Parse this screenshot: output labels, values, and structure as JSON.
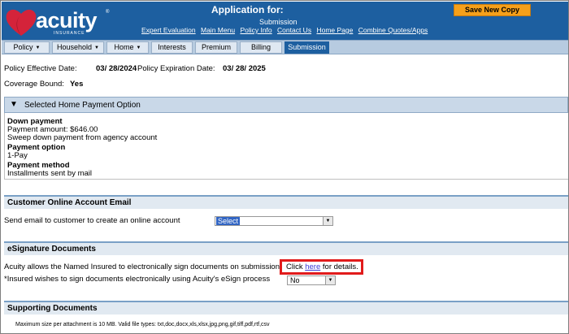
{
  "header": {
    "logo_text": "acuity",
    "logo_sub": "INSURANCE",
    "logo_reg": "®",
    "app_title": "Application for:",
    "app_subtitle": "Submission",
    "links": [
      "Expert Evaluation",
      "Main Menu",
      "Policy Info",
      "Contact Us",
      "Home Page",
      "Combine Quotes/Apps"
    ],
    "save_label": "Save New Copy"
  },
  "nav": {
    "tabs": [
      {
        "label": "Policy",
        "dropdown": true
      },
      {
        "label": "Household",
        "dropdown": true
      },
      {
        "label": "Home",
        "dropdown": true
      },
      {
        "label": "Interests",
        "dropdown": false
      },
      {
        "label": "Premium",
        "dropdown": false
      },
      {
        "label": "Billing",
        "dropdown": false
      },
      {
        "label": "Submission",
        "dropdown": false,
        "active": true
      }
    ]
  },
  "policy": {
    "effective_label": "Policy Effective Date:",
    "effective_value": "03/ 28/2024",
    "expiration_label": "Policy Expiration Date:",
    "expiration_value": "03/ 28/ 2025",
    "coverage_label": "Coverage Bound:",
    "coverage_value": "Yes"
  },
  "payment": {
    "section_title": "Selected Home Payment Option",
    "down_payment_label": "Down payment",
    "payment_amount": "Payment amount: $646.00",
    "sweep": "Sweep down payment from agency account",
    "option_label": "Payment option",
    "option_value": "1-Pay",
    "method_label": "Payment method",
    "method_value": "Installments sent by mail"
  },
  "email": {
    "section_title": "Customer Online Account Email",
    "prompt": "Send email to customer to create an online account",
    "select_value": "Select"
  },
  "esign": {
    "section_title": "eSignature Documents",
    "info": "Acuity allows the Named Insured to electronically sign documents on submission.",
    "click_pre": "Click",
    "click_link": "here",
    "click_post": "for details.",
    "wish_label": "*Insured wishes to sign documents electronically using Acuity's eSign process",
    "wish_value": "No"
  },
  "supporting": {
    "section_title": "Supporting Documents",
    "note": "Maximum size per attachment is 10 MB. Valid file types: txt,doc,docx,xls,xlsx,jpg,png,gif,tiff,pdf,rtf,csv"
  },
  "colors": {
    "header_blue": "#1d5fa0",
    "save_orange": "#f6a01a",
    "highlight_red": "#e11b1b",
    "logo_heart": "#d4233a"
  }
}
